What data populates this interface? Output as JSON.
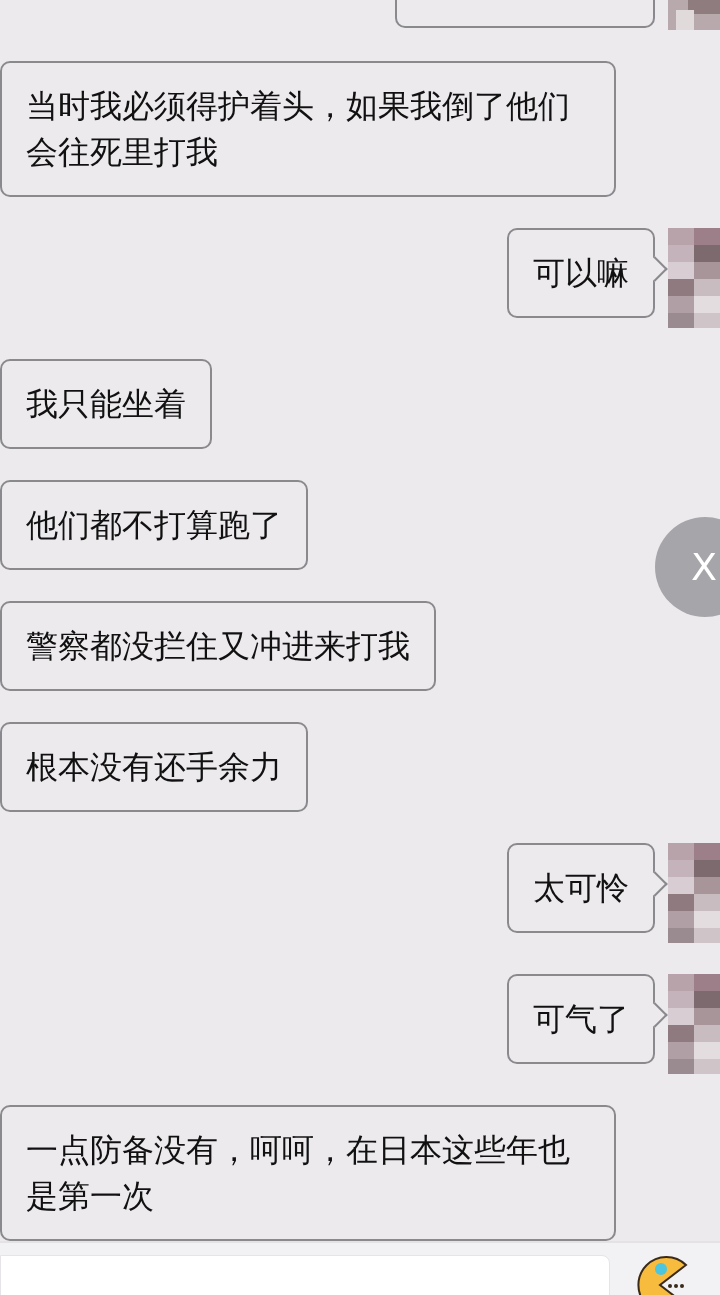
{
  "messages": [
    {
      "outgoing": true,
      "kind": "cutoff"
    },
    {
      "outgoing": false,
      "kind": "text",
      "text": "当时我必须得护着头，如果我倒了他们会往死里打我"
    },
    {
      "outgoing": true,
      "kind": "text",
      "text": "可以嘛"
    },
    {
      "outgoing": false,
      "kind": "text",
      "text": "我只能坐着"
    },
    {
      "outgoing": false,
      "kind": "text",
      "text": "他们都不打算跑了"
    },
    {
      "outgoing": false,
      "kind": "text",
      "text": "警察都没拦住又冲进来打我"
    },
    {
      "outgoing": false,
      "kind": "text",
      "text": "根本没有还手余力"
    },
    {
      "outgoing": true,
      "kind": "text",
      "text": "太可怜"
    },
    {
      "outgoing": true,
      "kind": "text",
      "text": "可气了"
    },
    {
      "outgoing": false,
      "kind": "text",
      "text": "一点防备没有，呵呵，在日本这些年也是第一次"
    }
  ],
  "float_button": {
    "label": "X"
  }
}
